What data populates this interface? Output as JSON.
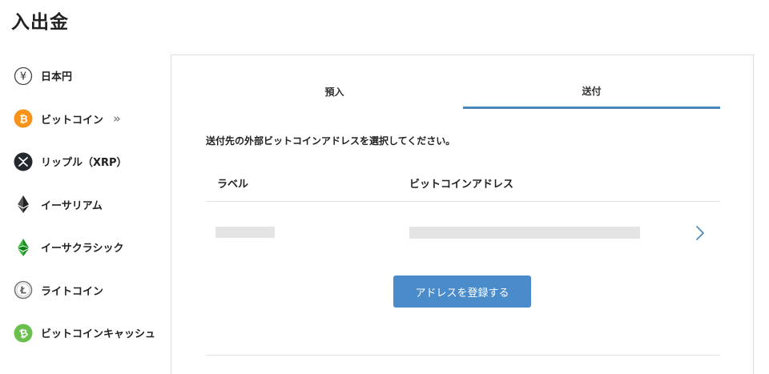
{
  "page": {
    "title": "入出金"
  },
  "sidebar": {
    "items": [
      {
        "label": "日本円",
        "icon": "yen-icon",
        "active": false
      },
      {
        "label": "ビットコイン",
        "icon": "bitcoin-icon",
        "active": true,
        "marker": "»"
      },
      {
        "label": "リップル（XRP）",
        "icon": "xrp-icon",
        "active": false
      },
      {
        "label": "イーサリアム",
        "icon": "ethereum-icon",
        "active": false
      },
      {
        "label": "イーサクラシック",
        "icon": "ethereum-classic-icon",
        "active": false
      },
      {
        "label": "ライトコイン",
        "icon": "litecoin-icon",
        "active": false
      },
      {
        "label": "ビットコインキャッシュ",
        "icon": "bitcoin-cash-icon",
        "active": false
      }
    ]
  },
  "panel": {
    "tabs": [
      {
        "label": "預入",
        "active": false
      },
      {
        "label": "送付",
        "active": true
      }
    ],
    "instruction": "送付先の外部ビットコインアドレスを選択してください。",
    "table": {
      "headers": {
        "label": "ラベル",
        "address": "ビットコインアドレス"
      }
    },
    "register_button": "アドレスを登録する"
  },
  "colors": {
    "accent": "#4a86b8",
    "button": "#4a8bc9",
    "bitcoin": "#f7931a",
    "ethereum_classic": "#3ab83a",
    "bitcoin_cash": "#6ac04c"
  }
}
